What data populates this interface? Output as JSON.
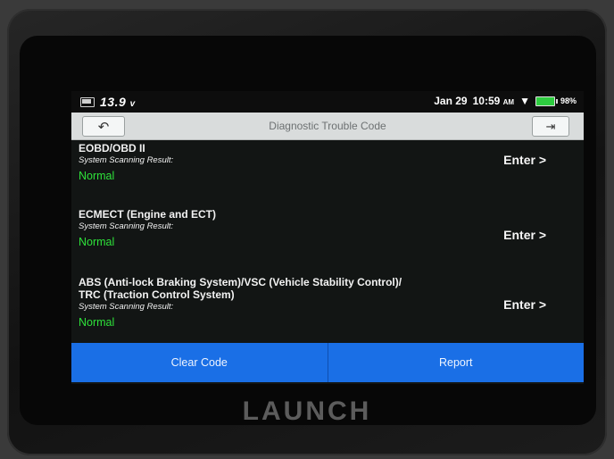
{
  "status_bar": {
    "voltage": "13.9",
    "voltage_unit": "v",
    "date": "Jan 29",
    "time": "10:59",
    "ampm": "AM",
    "battery_pct": "98%"
  },
  "header": {
    "title": "Diagnostic Trouble Code",
    "back_icon": "back-arrow-icon",
    "exit_icon": "exit-icon"
  },
  "systems": [
    {
      "name": "EOBD/OBD II",
      "subtitle": "System Scanning Result:",
      "status": "Normal",
      "action": "Enter >"
    },
    {
      "name": "ECMECT (Engine and ECT)",
      "subtitle": "System Scanning Result:",
      "status": "Normal",
      "action": "Enter >"
    },
    {
      "name": "ABS (Anti-lock Braking System)/VSC (Vehicle Stability Control)/\nTRC (Traction Control System)",
      "subtitle": "System Scanning Result:",
      "status": "Normal",
      "action": "Enter >"
    }
  ],
  "footer": {
    "clear_label": "Clear Code",
    "report_label": "Report"
  },
  "brand": "LAUNCH",
  "colors": {
    "accent": "#1a6fe6",
    "status_normal": "#2ee23a",
    "title_bar": "#d9dcdc"
  }
}
